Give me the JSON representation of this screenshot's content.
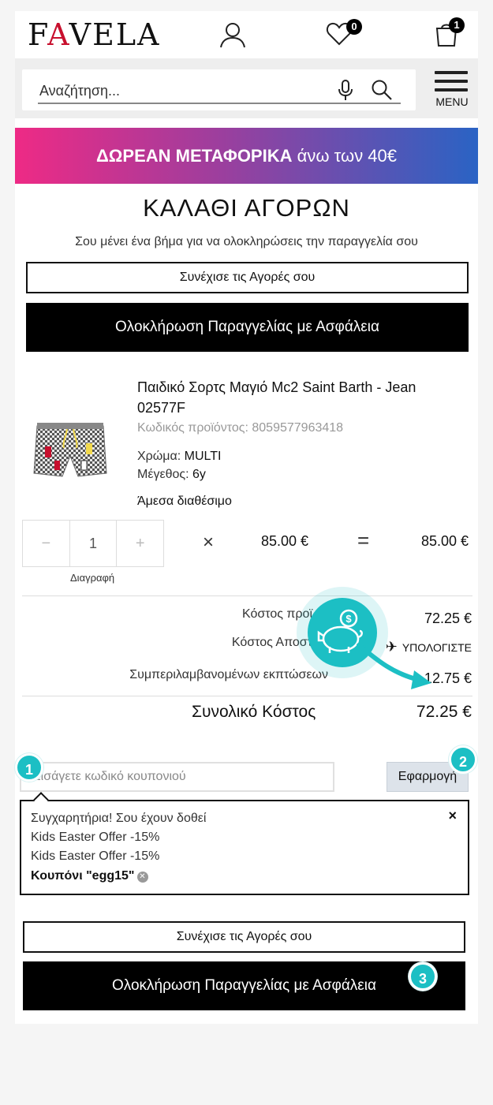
{
  "header": {
    "logo_text": "FAVELA",
    "wishlist_count": "0",
    "cart_count": "1"
  },
  "search": {
    "placeholder": "Αναζήτηση...",
    "menu_label": "MENU"
  },
  "promo": {
    "bold": "ΔΩΡΕΑΝ ΜΕΤΑΦΟΡΙΚΑ",
    "rest": "άνω των 40€"
  },
  "cart": {
    "title": "ΚΑΛΑΘΙ ΑΓΟΡΩΝ",
    "subtitle": "Σου μένει ένα βήμα για να ολοκληρώσεις την παραγγελία σου",
    "continue_label": "Συνέχισε τις Αγορές σου",
    "checkout_label": "Ολοκλήρωση Παραγγελίας με Ασφάλεια"
  },
  "product": {
    "name": "Παιδικό Σορτς Μαγιό Mc2 Saint Barth - Jean 02577F",
    "code": "Κωδικός προϊόντος: 8059577963418",
    "color_label": "Χρώμα:",
    "color_value": "MULTI",
    "size_label": "Μέγεθος:",
    "size_value": "6y",
    "availability": "Άμεσα διαθέσιμο",
    "qty_minus": "−",
    "quantity": "1",
    "qty_plus": "+",
    "delete_label": "Διαγραφή",
    "times_sign": "×",
    "unit_price": "85.00 €",
    "equals_sign": "=",
    "line_total": "85.00 €"
  },
  "summary": {
    "products_cost_label": "Κόστος προϊ",
    "products_cost_value": "72.25 €",
    "shipping_label": "Κόστος Αποστ",
    "shipping_value": "ΥΠΟΛΟΓΙΣΤΕ",
    "discounts_label": "Συμπεριλαμβανομένων εκπτώσεων",
    "discounts_value": "-12.75 €",
    "total_label": "Συνολικό Κόστος",
    "total_value": "72.25 €"
  },
  "coupon": {
    "placeholder": "Εισάγετε κωδικό κουπονιού",
    "apply_label": "Εφαρμογή",
    "congrats": "Συγχαρητήρια! Σου έχουν δοθεί",
    "offer_1": "Kids Easter Offer -15%",
    "offer_2": "Kids Easter Offer -15%",
    "code_label": "Κουπόνι \"egg15\"",
    "close_symbol": "×"
  },
  "annotations": {
    "step_1": "1",
    "step_2": "2",
    "step_3": "3",
    "accent_color": "#1cbfc4"
  }
}
